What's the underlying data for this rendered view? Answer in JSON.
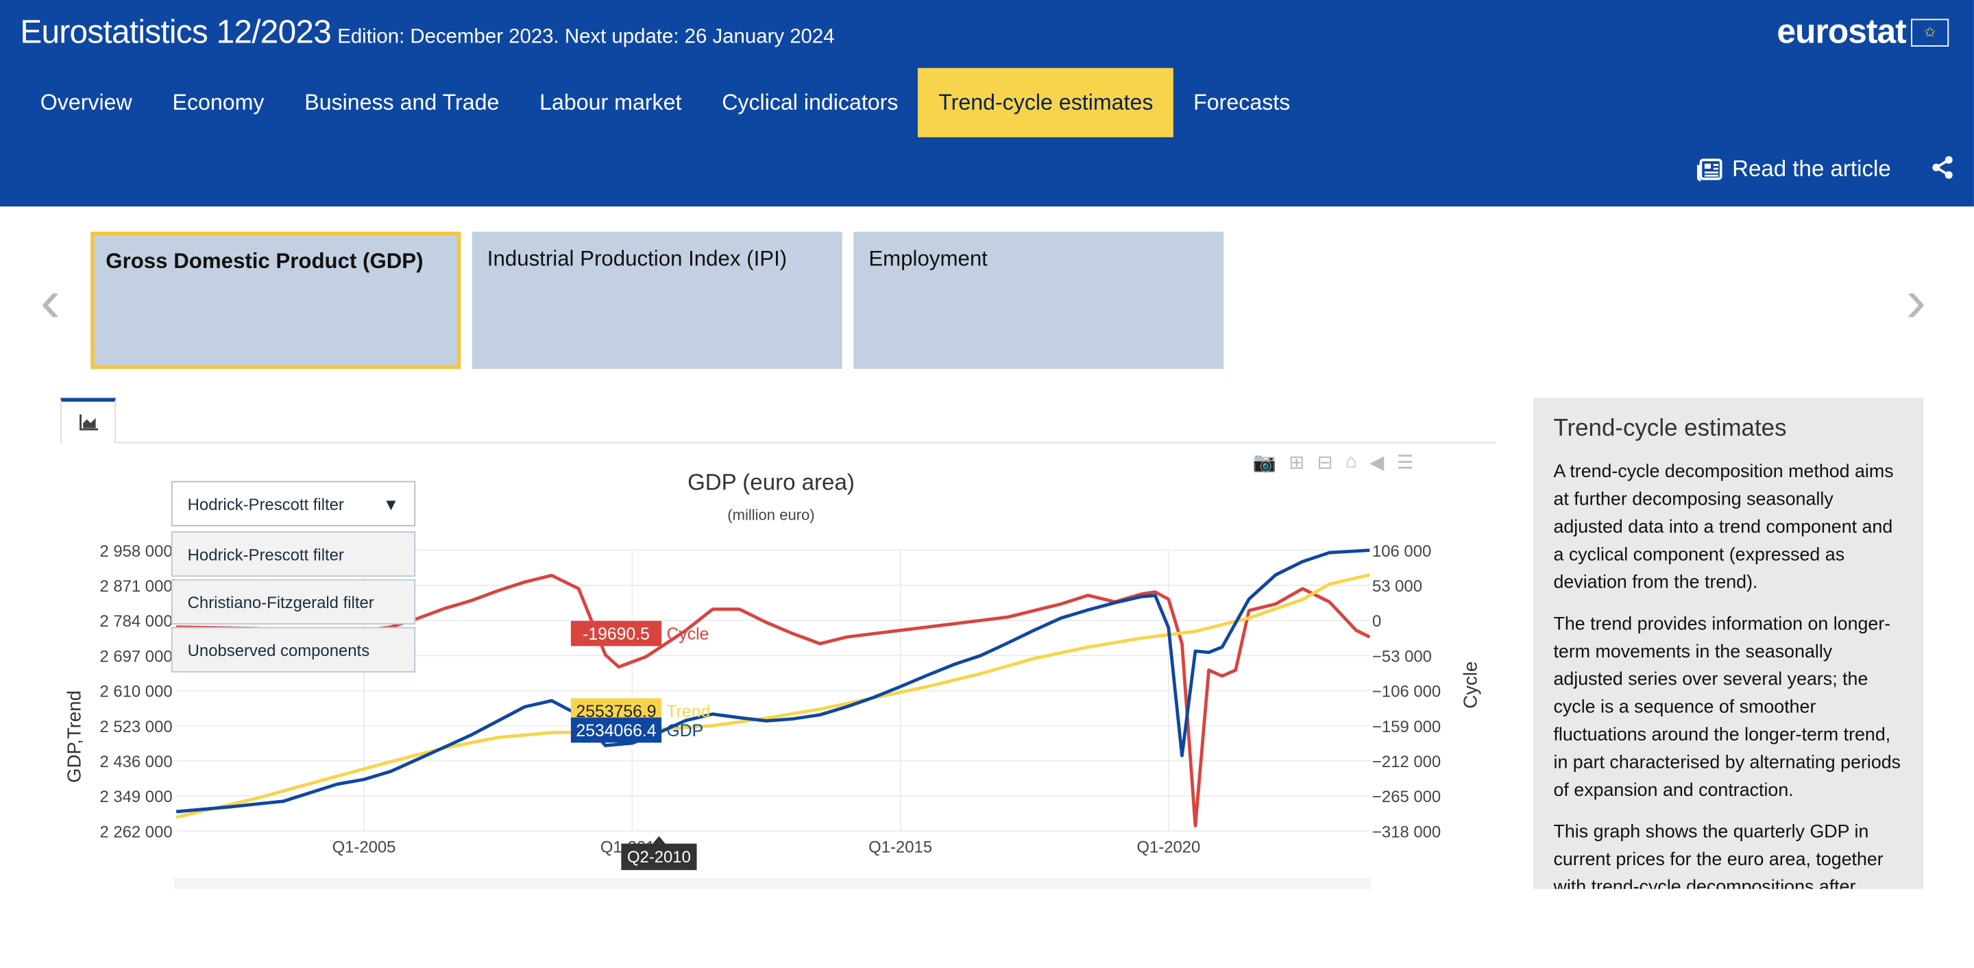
{
  "header": {
    "title": "Eurostatistics 12/2023",
    "edition": "Edition: December 2023. Next update: 26 January 2024",
    "logo": "eurostat",
    "read_article": "Read the article"
  },
  "nav": [
    "Overview",
    "Economy",
    "Business and Trade",
    "Labour market",
    "Cyclical indicators",
    "Trend-cycle estimates",
    "Forecasts"
  ],
  "nav_active": "Trend-cycle estimates",
  "indicator_tabs": [
    "Gross Domestic Product (GDP)",
    "Industrial Production Index (IPI)",
    "Employment"
  ],
  "filter": {
    "selected": "Hodrick-Prescott filter",
    "options": [
      "Hodrick-Prescott filter",
      "Christiano-Fitzgerald filter",
      "Unobserved components"
    ]
  },
  "chart_data": {
    "type": "line",
    "title": "GDP (euro area)",
    "subtitle": "(million euro)",
    "ylabel": "GDP,Trend",
    "y2label": "Cycle",
    "ylim": [
      2262000,
      2958000
    ],
    "y2lim": [
      -318000,
      106000
    ],
    "yticks": [
      "2 958 000",
      "2 871 000",
      "2 784 000",
      "2 697 000",
      "2 610 000",
      "2 523 000",
      "2 436 000",
      "2 349 000",
      "2 262 000"
    ],
    "y2ticks": [
      "106 000",
      "53 000",
      "0",
      "−53 000",
      "−106 000",
      "−159 000",
      "−212 000",
      "−265 000",
      "−318 000"
    ],
    "xticks": [
      "Q1-2005",
      "Q1-2010",
      "Q1-2015",
      "Q1-2020"
    ],
    "x_start": 2001.5,
    "x_end": 2023.75,
    "colors": {
      "GDP": "#0e47a1",
      "Trend": "#f7d44c",
      "Cycle": "#d9443e"
    },
    "hover": {
      "x": "Q2-2010",
      "cycle_value": "-19690.5",
      "trend_value": "2553756.9",
      "gdp_value": "2534066.4"
    },
    "series": [
      {
        "name": "GDP",
        "values": [
          [
            2001.5,
            2310000
          ],
          [
            2002.5,
            2322000
          ],
          [
            2003.5,
            2336000
          ],
          [
            2004.5,
            2378000
          ],
          [
            2005,
            2390000
          ],
          [
            2005.5,
            2410000
          ],
          [
            2006,
            2440000
          ],
          [
            2006.5,
            2470000
          ],
          [
            2007,
            2500000
          ],
          [
            2007.5,
            2535000
          ],
          [
            2008,
            2570000
          ],
          [
            2008.5,
            2585000
          ],
          [
            2009,
            2550000
          ],
          [
            2009.5,
            2474000
          ],
          [
            2010,
            2480000
          ],
          [
            2010.5,
            2506000
          ],
          [
            2011,
            2536000
          ],
          [
            2011.5,
            2552000
          ],
          [
            2012,
            2543000
          ],
          [
            2012.5,
            2535000
          ],
          [
            2013,
            2540000
          ],
          [
            2013.5,
            2550000
          ],
          [
            2014,
            2570000
          ],
          [
            2014.5,
            2593000
          ],
          [
            2015,
            2620000
          ],
          [
            2015.5,
            2648000
          ],
          [
            2016,
            2675000
          ],
          [
            2016.5,
            2697000
          ],
          [
            2017,
            2728000
          ],
          [
            2017.5,
            2760000
          ],
          [
            2018,
            2790000
          ],
          [
            2018.5,
            2810000
          ],
          [
            2019,
            2828000
          ],
          [
            2019.5,
            2843000
          ],
          [
            2019.75,
            2846000
          ],
          [
            2020,
            2766000
          ],
          [
            2020.25,
            2449000
          ],
          [
            2020.5,
            2708000
          ],
          [
            2020.75,
            2705000
          ],
          [
            2021,
            2718000
          ],
          [
            2021.5,
            2837000
          ],
          [
            2022,
            2897000
          ],
          [
            2022.5,
            2930000
          ],
          [
            2023,
            2952000
          ],
          [
            2023.75,
            2958000
          ]
        ]
      },
      {
        "name": "Trend",
        "values": [
          [
            2001.5,
            2296000
          ],
          [
            2003,
            2343000
          ],
          [
            2004.5,
            2398000
          ],
          [
            2005.5,
            2434000
          ],
          [
            2006.5,
            2468000
          ],
          [
            2007.5,
            2494000
          ],
          [
            2008.5,
            2506000
          ],
          [
            2009.5,
            2508000
          ],
          [
            2010.5,
            2514000
          ],
          [
            2011.5,
            2523000
          ],
          [
            2012.5,
            2542000
          ],
          [
            2013.5,
            2564000
          ],
          [
            2014.5,
            2592000
          ],
          [
            2015.5,
            2620000
          ],
          [
            2016.5,
            2652000
          ],
          [
            2017.5,
            2690000
          ],
          [
            2018.5,
            2718000
          ],
          [
            2019.5,
            2740000
          ],
          [
            2020.5,
            2757000
          ],
          [
            2021.5,
            2790000
          ],
          [
            2022.5,
            2836000
          ],
          [
            2023,
            2874000
          ],
          [
            2023.75,
            2897000
          ]
        ]
      },
      {
        "name": "Cycle",
        "values": [
          [
            2001.5,
            -10000
          ],
          [
            2003,
            -12000
          ],
          [
            2004,
            -15000
          ],
          [
            2005,
            -15000
          ],
          [
            2005.5,
            -10000
          ],
          [
            2006,
            3000
          ],
          [
            2006.5,
            18000
          ],
          [
            2007,
            30000
          ],
          [
            2007.5,
            45000
          ],
          [
            2008,
            58000
          ],
          [
            2008.5,
            68000
          ],
          [
            2009,
            48000
          ],
          [
            2009.5,
            -52000
          ],
          [
            2009.75,
            -70000
          ],
          [
            2010.25,
            -55000
          ],
          [
            2010.5,
            -42000
          ],
          [
            2011,
            -15000
          ],
          [
            2011.5,
            17000
          ],
          [
            2012,
            17000
          ],
          [
            2012.5,
            -3000
          ],
          [
            2013,
            -20000
          ],
          [
            2013.5,
            -35000
          ],
          [
            2014,
            -25000
          ],
          [
            2015,
            -15000
          ],
          [
            2016,
            -5000
          ],
          [
            2017,
            5000
          ],
          [
            2018,
            25000
          ],
          [
            2018.5,
            38000
          ],
          [
            2019,
            28000
          ],
          [
            2019.5,
            40000
          ],
          [
            2019.75,
            43000
          ],
          [
            2020,
            32000
          ],
          [
            2020.25,
            -35000
          ],
          [
            2020.5,
            -310000
          ],
          [
            2020.75,
            -75000
          ],
          [
            2021,
            -84000
          ],
          [
            2021.25,
            -75000
          ],
          [
            2021.5,
            15000
          ],
          [
            2022,
            25000
          ],
          [
            2022.5,
            48000
          ],
          [
            2023,
            28000
          ],
          [
            2023.5,
            -15000
          ],
          [
            2023.75,
            -25000
          ]
        ]
      }
    ],
    "legend_labels": [
      "Cycle",
      "Trend",
      "GDP"
    ]
  },
  "side_panel": {
    "title": "Trend-cycle estimates",
    "paragraphs": [
      "A trend-cycle decomposition method aims at further decomposing seasonally adjusted data into a trend component and a cyclical component (expressed as deviation from the trend).",
      "The trend provides information on longer-term movements in the seasonally adjusted series over several years; the cycle is a sequence of smoother fluctuations around the longer-term trend, in part characterised by alternating periods of expansion and contraction.",
      "This graph shows the quarterly GDP in current prices for the euro area, together with trend-cycle decompositions after applying three alternative filters for their estimation."
    ]
  }
}
